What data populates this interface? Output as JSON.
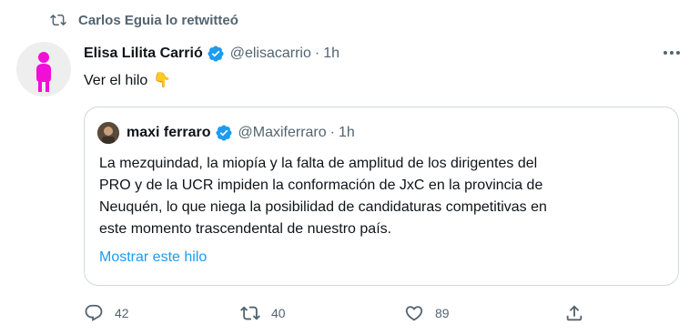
{
  "retweet": {
    "icon": "retweet-icon",
    "text": "Carlos Eguia lo retwitteó"
  },
  "tweet": {
    "author_name": "Elisa Lilita Carrió",
    "handle": "@elisacarrio",
    "separator": "·",
    "time": "1h",
    "text": "Ver el hilo",
    "emoji": "👇",
    "verified": true,
    "more_icon": "more-icon"
  },
  "quoted_tweet": {
    "author_name": "maxi ferraro",
    "handle": "@Maxiferraro",
    "separator": "·",
    "time": "1h",
    "verified": true,
    "lines": [
      "La mezquindad, la miopía y la falta de amplitud de los dirigentes del",
      "PRO y de la UCR impiden la conformación de JxC en la provincia de",
      "Neuquén, lo que niega la posibilidad de candidaturas competitivas en",
      "este momento trascendental de nuestro país."
    ],
    "show_thread": "Mostrar este hilo"
  },
  "actions": {
    "reply": {
      "icon": "reply-icon",
      "count": "42"
    },
    "retweet": {
      "icon": "retweet-icon",
      "count": "40"
    },
    "like": {
      "icon": "heart-icon",
      "count": "89"
    },
    "share": {
      "icon": "share-icon"
    }
  },
  "colors": {
    "accent": "#1d9bf0",
    "secondary_text": "#536471",
    "border": "#cfd9de",
    "avatar_figure": "#f10fd8"
  }
}
